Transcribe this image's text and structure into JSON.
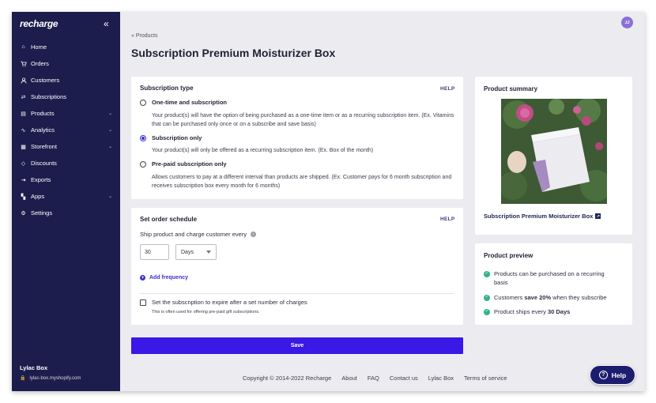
{
  "sidebar": {
    "logo": "recharge",
    "collapse_icon": "«",
    "items": [
      {
        "label": "Home",
        "icon": "home-icon",
        "glyph": "⌂",
        "chevron": ""
      },
      {
        "label": "Orders",
        "icon": "cart-icon",
        "glyph": "🛒",
        "chevron": ""
      },
      {
        "label": "Customers",
        "icon": "user-icon",
        "glyph": "●",
        "chevron": ""
      },
      {
        "label": "Subscriptions",
        "icon": "refresh-icon",
        "glyph": "⇄",
        "chevron": ""
      },
      {
        "label": "Products",
        "icon": "box-icon",
        "glyph": "▤",
        "chevron": "⌄"
      },
      {
        "label": "Analytics",
        "icon": "trend-icon",
        "glyph": "∿",
        "chevron": "⌄"
      },
      {
        "label": "Storefront",
        "icon": "storefront-icon",
        "glyph": "▦",
        "chevron": "⌄"
      },
      {
        "label": "Discounts",
        "icon": "tag-icon",
        "glyph": "◇",
        "chevron": ""
      },
      {
        "label": "Exports",
        "icon": "export-icon",
        "glyph": "⇥",
        "chevron": ""
      },
      {
        "label": "Apps",
        "icon": "apps-icon",
        "glyph": "▚",
        "chevron": "⌄"
      },
      {
        "label": "Settings",
        "icon": "gear-icon",
        "glyph": "⚙",
        "chevron": ""
      }
    ],
    "store_name": "Lylac Box",
    "store_url": "lylac-box.myshopify.com"
  },
  "header": {
    "avatar_initials": "JJ",
    "breadcrumb": "« Products",
    "title": "Subscription Premium Moisturizer Box"
  },
  "subscription_type": {
    "title": "Subscription type",
    "help": "HELP",
    "options": [
      {
        "label": "One-time and subscription",
        "selected": false,
        "description": "Your product(s) will have the option of being purchased as a one-time item or as a recurring subscription item. (Ex. Vitamins that can be purchased only once or on a subscribe and save basis)"
      },
      {
        "label": "Subscription only",
        "selected": true,
        "description": "Your product(s) will only be offered as a recurring subscription item. (Ex. Box of the month)"
      },
      {
        "label": "Pre-paid subscription only",
        "selected": false,
        "description": "Allows customers to pay at a different interval than products are shipped. (Ex. Customer pays for 6 month subscription and receives subscription box every month for 6 months)"
      }
    ]
  },
  "order_schedule": {
    "title": "Set order schedule",
    "help": "HELP",
    "field_label": "Ship product and charge customer every",
    "frequency_value": "30",
    "frequency_unit": "Days",
    "add_frequency": "Add frequency",
    "expire_label": "Set the subscription to expire after a set number of charges",
    "expire_note": "This is often used for offering pre-paid gift subscriptions."
  },
  "save_label": "Save",
  "product_summary": {
    "title": "Product summary",
    "product_name": "Subscription Premium Moisturizer Box"
  },
  "product_preview": {
    "title": "Product preview",
    "items": [
      {
        "parts": [
          "Products can be purchased on a recurring basis"
        ]
      },
      {
        "parts": [
          "Customers ",
          "save 20%",
          " when they subscribe"
        ]
      },
      {
        "parts": [
          "Product ships every ",
          "30 Days"
        ]
      }
    ]
  },
  "footer": {
    "copyright": "Copyright © 2014-2022 Recharge",
    "links": [
      "About",
      "FAQ",
      "Contact us",
      "Lylac Box",
      "Terms of service"
    ]
  },
  "help_button": "Help",
  "colors": {
    "sidebar": "#1c1d4c",
    "primary": "#3a18e6",
    "success": "#2fb583"
  }
}
